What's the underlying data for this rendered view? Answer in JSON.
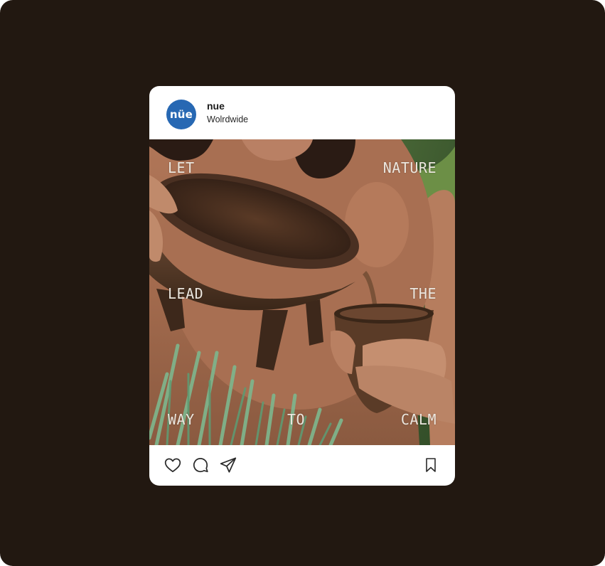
{
  "post": {
    "avatar_text": "nüe",
    "username": "nue",
    "location": "Wolrdwide",
    "overlay_words": {
      "let": "LET",
      "nature": "NATURE",
      "lead": "LEAD",
      "the": "THE",
      "way": "WAY",
      "to": "TO",
      "calm": "CALM"
    },
    "actions": {
      "like_icon": "heart-icon",
      "comment_icon": "comment-icon",
      "share_icon": "send-icon",
      "save_icon": "bookmark-icon"
    }
  },
  "colors": {
    "background": "#221811",
    "card": "#ffffff",
    "avatar": "#2768b3",
    "overlay_text": "#ebe6de",
    "icon_stroke": "#2a2a2a"
  }
}
